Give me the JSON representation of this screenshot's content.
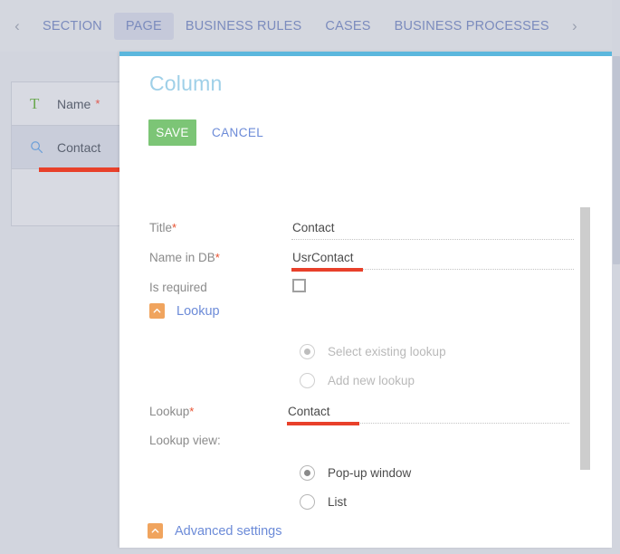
{
  "tabbar": {
    "prev_arrow": "‹",
    "next_arrow": "›",
    "tabs": [
      {
        "label": "SECTION",
        "active": false
      },
      {
        "label": "PAGE",
        "active": true
      },
      {
        "label": "BUSINESS RULES",
        "active": false
      },
      {
        "label": "CASES",
        "active": false
      },
      {
        "label": "BUSINESS PROCESSES",
        "active": false
      }
    ]
  },
  "field_list": {
    "rows": [
      {
        "label": "Name",
        "required_mark": "*",
        "icon": "text-column-icon",
        "icon_glyph": "T",
        "selected": false,
        "has_error": false
      },
      {
        "label": "Contact",
        "required_mark": "",
        "icon": "lookup-column-icon",
        "icon_glyph": "",
        "selected": true,
        "has_error": true
      }
    ]
  },
  "dialog": {
    "title": "Column",
    "accent_color": "#5bb7dd",
    "save_label": "SAVE",
    "save_color": "#7cc576",
    "cancel_label": "CANCEL",
    "link_color": "#6c8bd8",
    "error_color": "#e8402a",
    "fields": {
      "title": {
        "label": "Title",
        "star": "*",
        "value": "Contact",
        "has_error": false
      },
      "name_in_db": {
        "label": "Name in DB",
        "star": "*",
        "value": "UsrContact",
        "has_error": true
      },
      "is_required": {
        "label": "Is required",
        "star": "",
        "checked": false
      },
      "lookup_value": {
        "label": "Lookup",
        "star": "*",
        "value": "Contact",
        "has_error": true
      },
      "lookup_view": {
        "label": "Lookup view:",
        "star": ""
      }
    },
    "sections": {
      "lookup": {
        "label": "Lookup",
        "expanded": true,
        "icon": "chevron-up-icon",
        "icon_color": "#f0a45e"
      },
      "advanced": {
        "label": "Advanced settings",
        "expanded": true,
        "icon": "chevron-up-icon",
        "icon_color": "#f0a45e"
      }
    },
    "lookup_source_radios": [
      {
        "label": "Select existing lookup",
        "checked": true,
        "disabled": true
      },
      {
        "label": "Add new lookup",
        "checked": false,
        "disabled": true
      }
    ],
    "lookup_view_radios": [
      {
        "label": "Pop-up window",
        "checked": true,
        "disabled": false
      },
      {
        "label": "List",
        "checked": false,
        "disabled": false
      }
    ]
  }
}
